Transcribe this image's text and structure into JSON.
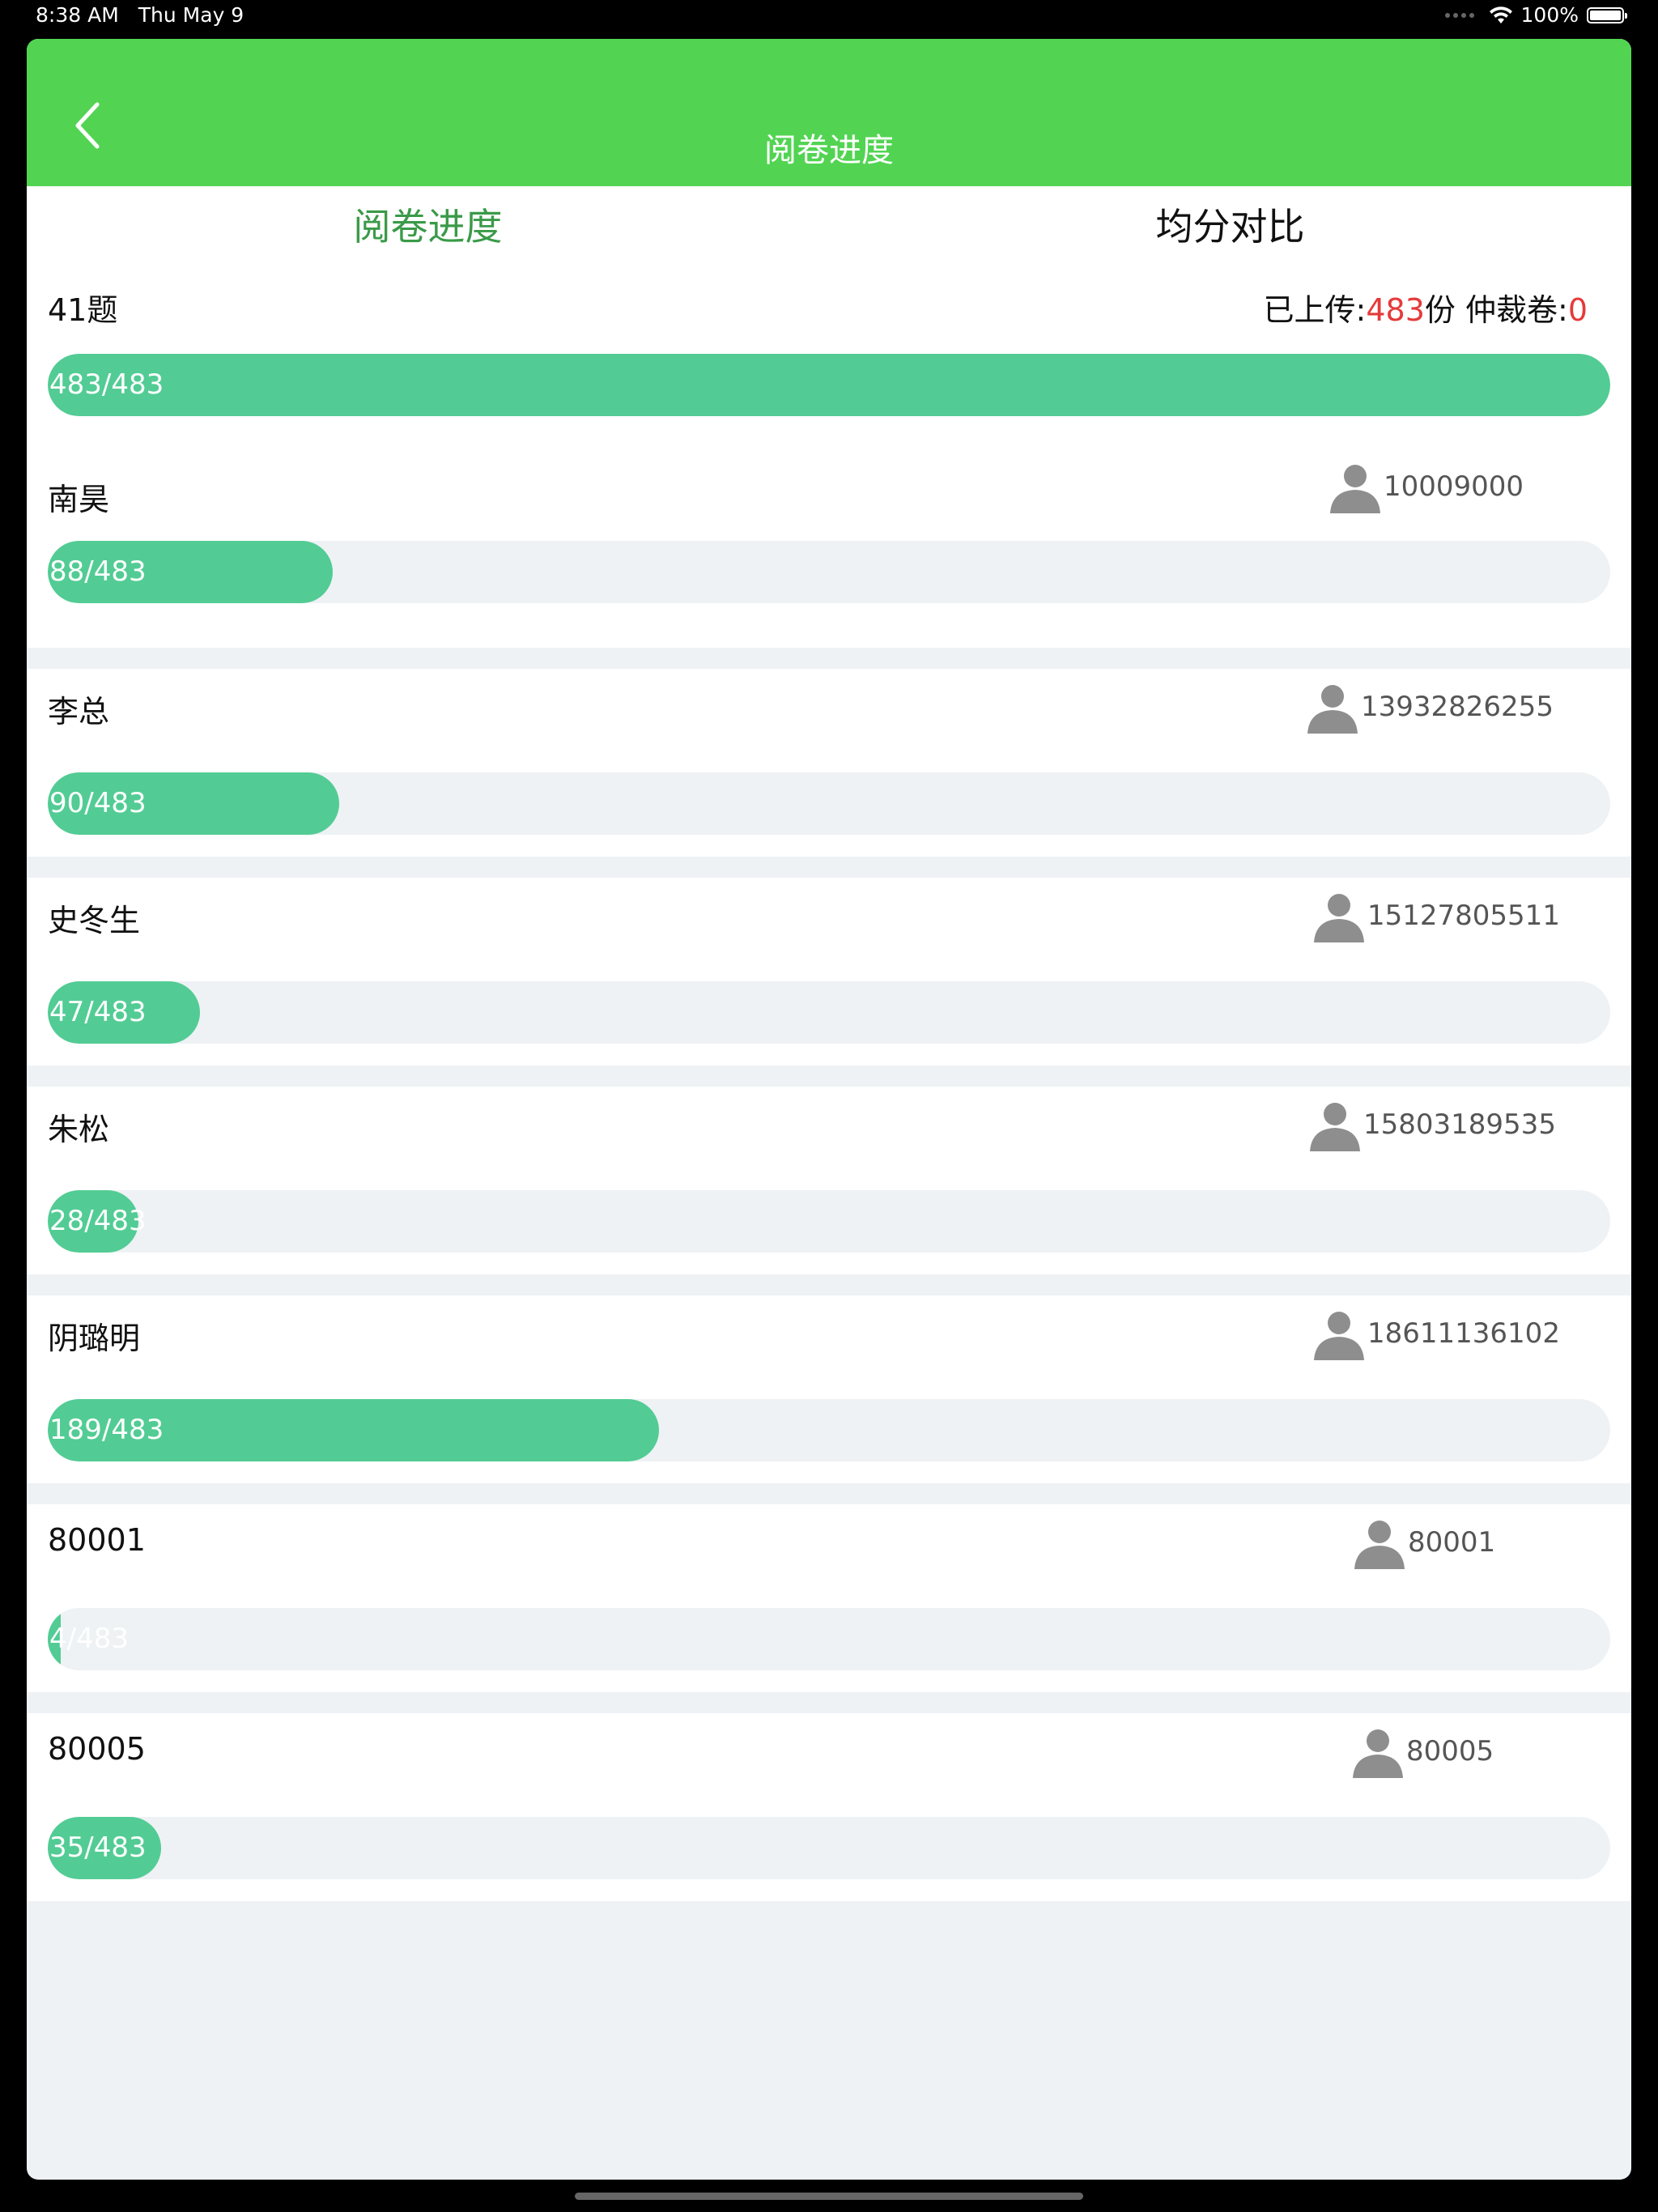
{
  "status_bar": {
    "time": "8:38 AM",
    "date": "Thu May 9",
    "battery": "100%",
    "icons": [
      "wifi-icon",
      "battery-icon"
    ]
  },
  "nav": {
    "title": "阅卷进度",
    "back_icon": "chevron-left-icon"
  },
  "tabs": [
    {
      "label": "阅卷进度",
      "active": true
    },
    {
      "label": "均分对比",
      "active": false
    }
  ],
  "colors": {
    "header": "#52d452",
    "active_tab": "#3a9a48",
    "progress_fill": "#52cc94",
    "progress_track": "#eef2f5",
    "highlight": "#e53a3a"
  },
  "summary": {
    "question": "41题",
    "uploaded_prefix": "已上传:",
    "uploaded_count": "483",
    "uploaded_suffix": "份",
    "arbitration_prefix": "仲裁卷:",
    "arbitration_count": "0",
    "progress_label": "483/483",
    "progress_done": 483,
    "progress_total": 483
  },
  "first_grader": {
    "name": "南昊",
    "account": "10009000",
    "progress_label": "88/483",
    "done": 88,
    "total": 483
  },
  "graders": [
    {
      "name": "李总",
      "account": "13932826255",
      "progress_label": "90/483",
      "done": 90,
      "total": 483
    },
    {
      "name": "史冬生",
      "account": "15127805511",
      "progress_label": "47/483",
      "done": 47,
      "total": 483
    },
    {
      "name": "朱松",
      "account": "15803189535",
      "progress_label": "28/483",
      "done": 28,
      "total": 483
    },
    {
      "name": "阴璐明",
      "account": "18611136102",
      "progress_label": "189/483",
      "done": 189,
      "total": 483
    },
    {
      "name": "80001",
      "account": "80001",
      "progress_label": "4/483",
      "done": 4,
      "total": 483
    },
    {
      "name": "80005",
      "account": "80005",
      "progress_label": "35/483",
      "done": 35,
      "total": 483
    }
  ]
}
